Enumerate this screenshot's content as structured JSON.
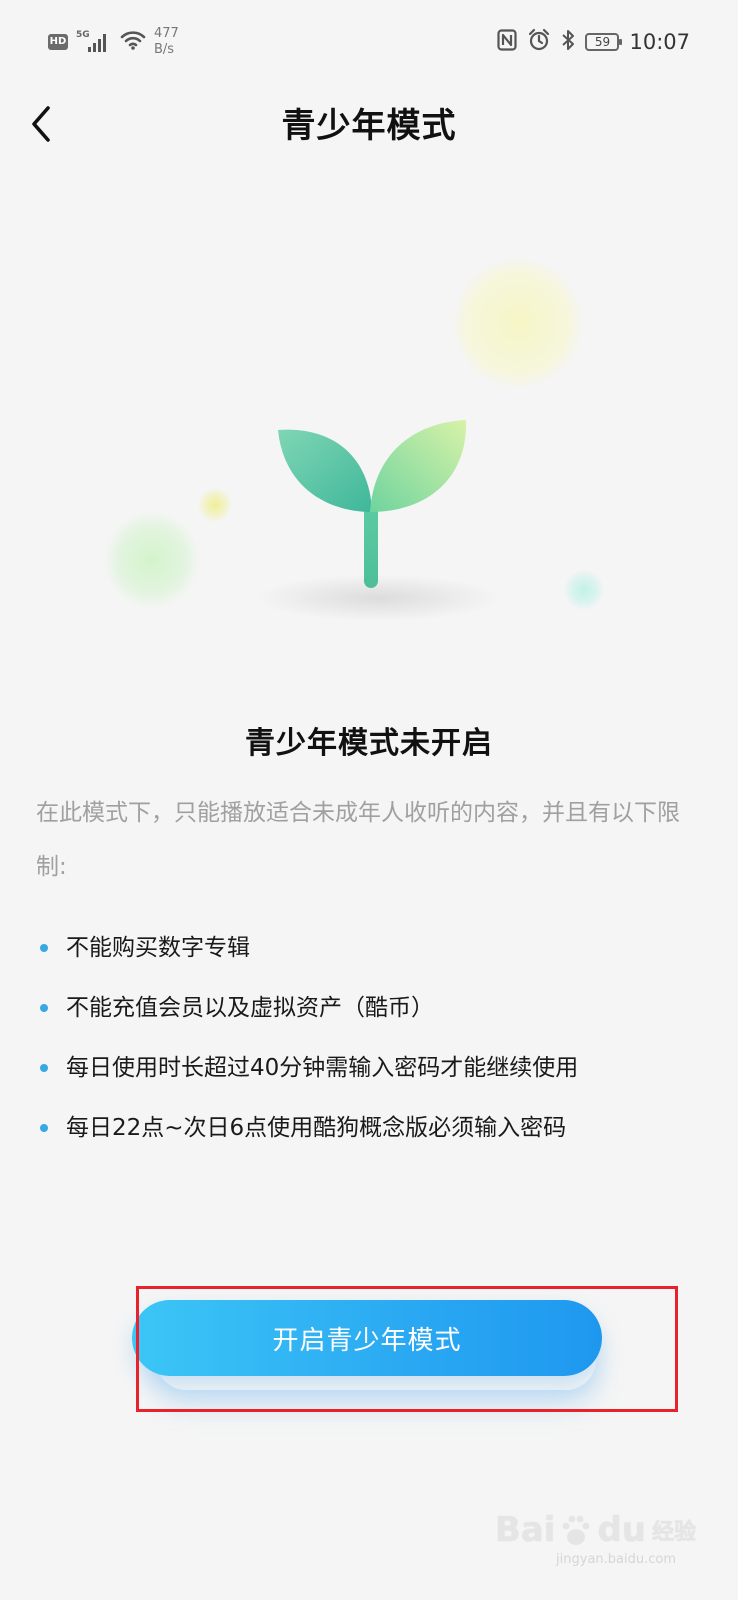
{
  "status_bar": {
    "hd_badge": "HD",
    "network_label": "5G",
    "net_speed_value": "477",
    "net_speed_unit": "B/s",
    "battery_level": "59",
    "time": "10:07",
    "icons": [
      "nfc-icon",
      "alarm-icon",
      "bluetooth-icon",
      "battery-icon",
      "wifi-icon",
      "signal-icon"
    ]
  },
  "header": {
    "back_icon": "chevron-left-icon",
    "title": "青少年模式"
  },
  "illustration": {
    "icon": "sprout-icon",
    "colors": {
      "leaf_left": "#4cc0a4",
      "leaf_right": "#9ee7a4",
      "stem": "#56c8a0"
    }
  },
  "main": {
    "status_title": "青少年模式未开启",
    "description": "在此模式下，只能播放适合未成年人收听的内容，并且有以下限制:",
    "restrictions": [
      "不能购买数字专辑",
      "不能充值会员以及虚拟资产（酷币）",
      "每日使用时长超过40分钟需输入密码才能继续使用",
      "每日22点~次日6点使用酷狗概念版必须输入密码"
    ],
    "bullet_color": "#37a8e6"
  },
  "action": {
    "enable_button_label": "开启青少年模式",
    "button_gradient": [
      "#3cc6f6",
      "#1e98ef"
    ],
    "highlight_color": "#e8222b"
  },
  "watermark": {
    "brand_left": "Bai",
    "brand_right": "du",
    "brand_sub": "经验",
    "url": "jingyan.baidu.com"
  }
}
